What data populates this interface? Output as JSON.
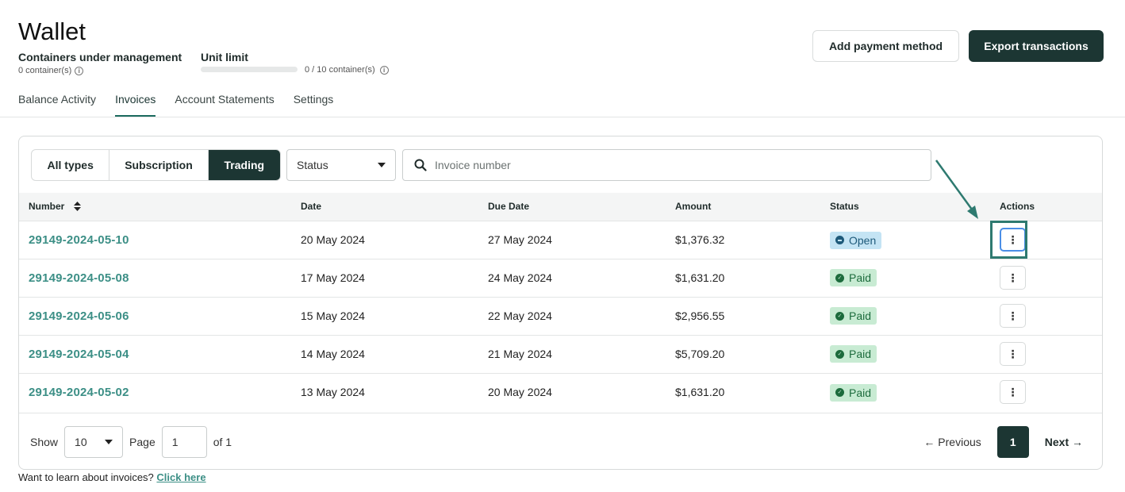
{
  "header": {
    "title": "Wallet",
    "containers_label": "Containers under management",
    "containers_value": "0 container(s)",
    "unit_limit_label": "Unit limit",
    "unit_limit_value": "0 / 10 container(s)",
    "unit_limit_fraction": 0,
    "info_glyph": "i",
    "add_payment_label": "Add payment method",
    "export_label": "Export transactions"
  },
  "tabs": [
    {
      "label": "Balance Activity",
      "active": false
    },
    {
      "label": "Invoices",
      "active": true
    },
    {
      "label": "Account Statements",
      "active": false
    },
    {
      "label": "Settings",
      "active": false
    }
  ],
  "filters": {
    "types": [
      {
        "label": "All types",
        "active": false
      },
      {
        "label": "Subscription",
        "active": false
      },
      {
        "label": "Trading",
        "active": true
      }
    ],
    "status_value": "Status",
    "search_placeholder": "Invoice number"
  },
  "table": {
    "columns": [
      "Number",
      "Date",
      "Due Date",
      "Amount",
      "Status",
      "Actions"
    ],
    "rows": [
      {
        "number": "29149-2024-05-10",
        "date": "20 May 2024",
        "due": "27 May 2024",
        "amount": "$1,376.32",
        "status": "Open"
      },
      {
        "number": "29149-2024-05-08",
        "date": "17 May 2024",
        "due": "24 May 2024",
        "amount": "$1,631.20",
        "status": "Paid"
      },
      {
        "number": "29149-2024-05-06",
        "date": "15 May 2024",
        "due": "22 May 2024",
        "amount": "$2,956.55",
        "status": "Paid"
      },
      {
        "number": "29149-2024-05-04",
        "date": "14 May 2024",
        "due": "21 May 2024",
        "amount": "$5,709.20",
        "status": "Paid"
      },
      {
        "number": "29149-2024-05-02",
        "date": "13 May 2024",
        "due": "20 May 2024",
        "amount": "$1,631.20",
        "status": "Paid"
      }
    ],
    "action_glyph": "⋮",
    "sort_glyph": "▲▼"
  },
  "pagination": {
    "show_label": "Show",
    "page_size": "10",
    "page_label": "Page",
    "page_value": "1",
    "of_label": "of 1",
    "previous_label": "← Previous",
    "current_page": "1",
    "next_label": "Next →"
  },
  "footer": {
    "text": "Want to learn about invoices?",
    "link": "Click here"
  },
  "colors": {
    "accent_dark": "#1c3633",
    "link_teal": "#3c8f86",
    "open_badge": "#c4e4f4",
    "paid_badge": "#c8ebd3",
    "annotation": "#2e7a70"
  }
}
